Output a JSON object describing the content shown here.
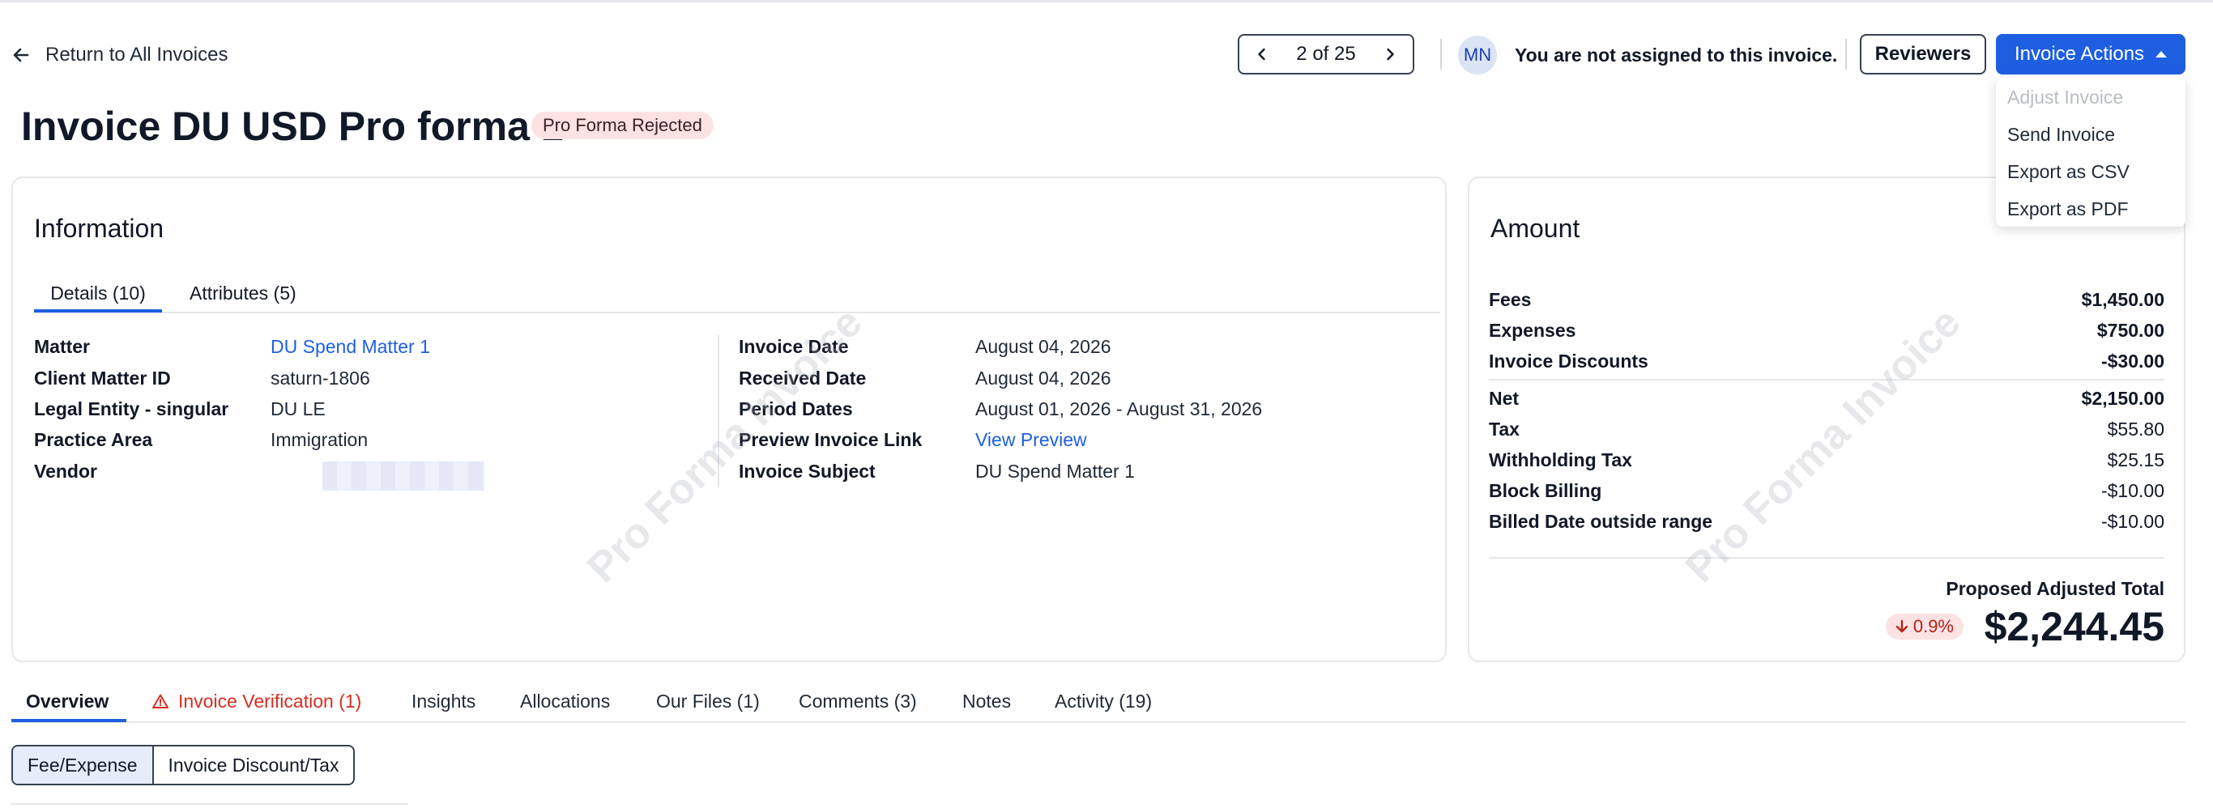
{
  "header": {
    "back_label": "Return to All Invoices",
    "pager": "2 of 25",
    "avatar": "MN",
    "assignment": "You are not assigned to this invoice.",
    "reviewers": "Reviewers",
    "actions": "Invoice Actions"
  },
  "actions_menu": [
    "Adjust Invoice",
    "Send Invoice",
    "Export as CSV",
    "Export as PDF"
  ],
  "title": "Invoice DU USD Pro forma 1",
  "status": "Pro Forma Rejected",
  "watermark": "Pro Forma Invoice",
  "info": {
    "title": "Information",
    "tabs": [
      "Details (10)",
      "Attributes (5)"
    ],
    "left": [
      {
        "label": "Matter",
        "value": "DU Spend Matter 1"
      },
      {
        "label": "Client Matter ID",
        "value": "saturn-1806"
      },
      {
        "label": "Legal Entity - singular",
        "value": "DU LE"
      },
      {
        "label": "Practice Area",
        "value": "Immigration"
      },
      {
        "label": "Vendor",
        "value": ""
      }
    ],
    "right": [
      {
        "label": "Invoice Date",
        "value": "August 04, 2026"
      },
      {
        "label": "Received Date",
        "value": "August 04, 2026"
      },
      {
        "label": "Period Dates",
        "value": "August 01, 2026 - August 31, 2026"
      },
      {
        "label": "Preview Invoice Link",
        "value": "View Preview"
      },
      {
        "label": "Invoice Subject",
        "value": "DU Spend Matter 1"
      }
    ]
  },
  "amount": {
    "title": "Amount",
    "rows": [
      {
        "label": "Fees",
        "value": "$1,450.00"
      },
      {
        "label": "Expenses",
        "value": "$750.00"
      },
      {
        "label": "Invoice Discounts",
        "value": "-$30.00"
      },
      {
        "label": "Net",
        "value": "$2,150.00"
      },
      {
        "label": "Tax",
        "value": "$55.80"
      },
      {
        "label": "Withholding Tax",
        "value": "$25.15"
      },
      {
        "label": "Block Billing",
        "value": "-$10.00"
      },
      {
        "label": "Billed Date outside range",
        "value": "-$10.00"
      }
    ],
    "total_label": "Proposed Adjusted Total",
    "change": "0.9%",
    "total": "$2,244.45"
  },
  "bottom_tabs": [
    "Overview",
    "Invoice Verification (1)",
    "Insights",
    "Allocations",
    "Our Files (1)",
    "Comments (3)",
    "Notes",
    "Activity (19)"
  ],
  "segments": [
    "Fee/Expense",
    "Invoice Discount/Tax"
  ],
  "colors": {
    "primary": "#1d5fe0",
    "danger": "#d92d20",
    "badge_bg": "#fde2e4"
  }
}
